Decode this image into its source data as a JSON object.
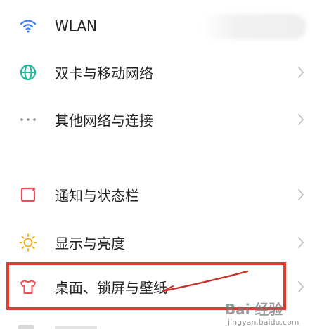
{
  "settings": {
    "items": [
      {
        "label": "WLAN",
        "icon": "wifi-icon",
        "icon_color": "#3b7cf0",
        "chevron": false
      },
      {
        "label": "双卡与移动网络",
        "icon": "globe-icon",
        "icon_color": "#1fb89a",
        "chevron": true
      },
      {
        "label": "其他网络与连接",
        "icon": "more-dots-icon",
        "icon_color": "#8a8a8a",
        "chevron": true
      },
      {
        "label": "通知与状态栏",
        "icon": "notification-icon",
        "icon_color": "#e8505b",
        "chevron": true
      },
      {
        "label": "显示与亮度",
        "icon": "sun-icon",
        "icon_color": "#f2b321",
        "chevron": true
      },
      {
        "label": "桌面、锁屏与壁纸",
        "icon": "shirt-icon",
        "icon_color": "#e8505b",
        "chevron": true
      }
    ]
  },
  "annotation": {
    "highlight_color": "#e23a2f"
  },
  "watermark": {
    "logo": "Bai 经验",
    "url": "jingyan.baidu.com"
  }
}
